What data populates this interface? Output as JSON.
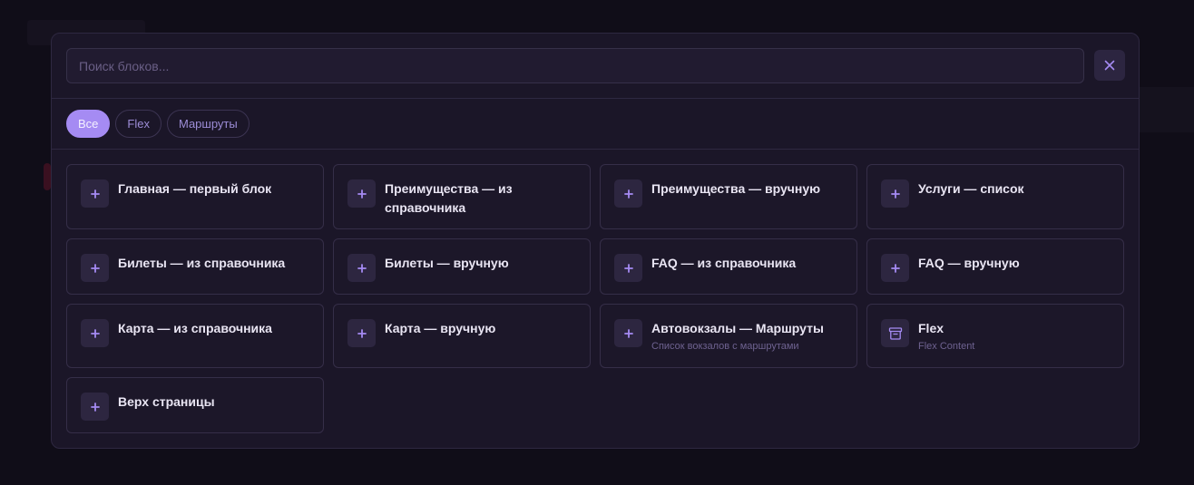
{
  "search": {
    "placeholder": "Поиск блоков..."
  },
  "filters": [
    {
      "label": "Все",
      "active": true
    },
    {
      "label": "Flex",
      "active": false
    },
    {
      "label": "Маршруты",
      "active": false
    }
  ],
  "blocks": [
    {
      "title": "Главная — первый блок",
      "subtitle": "",
      "icon": "plus-icon"
    },
    {
      "title": "Преимущества — из справочника",
      "subtitle": "",
      "icon": "plus-icon"
    },
    {
      "title": "Преимущества — вручную",
      "subtitle": "",
      "icon": "plus-icon"
    },
    {
      "title": "Услуги — список",
      "subtitle": "",
      "icon": "plus-icon"
    },
    {
      "title": "Билеты — из справочника",
      "subtitle": "",
      "icon": "plus-icon"
    },
    {
      "title": "Билеты — вручную",
      "subtitle": "",
      "icon": "plus-icon"
    },
    {
      "title": "FAQ — из справочника",
      "subtitle": "",
      "icon": "plus-icon"
    },
    {
      "title": "FAQ — вручную",
      "subtitle": "",
      "icon": "plus-icon"
    },
    {
      "title": "Карта — из справочника",
      "subtitle": "",
      "icon": "plus-icon"
    },
    {
      "title": "Карта — вручную",
      "subtitle": "",
      "icon": "plus-icon"
    },
    {
      "title": "Автовокзалы — Маршруты",
      "subtitle": "Список вокзалов с маршрутами",
      "icon": "plus-icon"
    },
    {
      "title": "Flex",
      "subtitle": "Flex Content",
      "icon": "archive-icon"
    },
    {
      "title": "Верх страницы",
      "subtitle": "",
      "icon": "plus-icon"
    }
  ],
  "colors": {
    "accent": "#a58bf3",
    "modal_bg": "#1b1628",
    "card_border": "#352e48"
  }
}
